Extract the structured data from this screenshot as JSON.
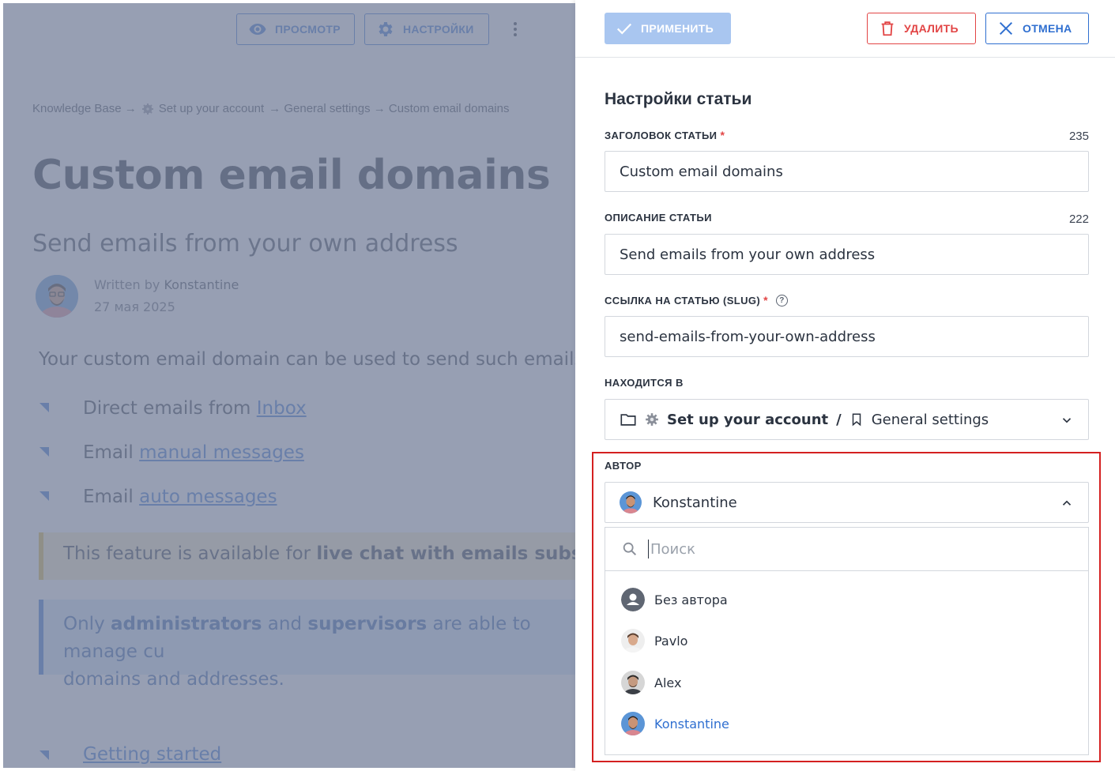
{
  "article": {
    "toolbar": {
      "preview_label": "ПРОСМОТР",
      "settings_label": "НАСТРОЙКИ"
    },
    "breadcrumb": {
      "root": "Knowledge Base →",
      "section": "Set up your account",
      "rest": "→ General settings → Custom email domains"
    },
    "title": "Custom email domains",
    "subtitle": "Send emails from your own address",
    "author": {
      "written_by": "Written by",
      "name": "Konstantine",
      "date": "27 мая 2025"
    },
    "intro": "Your custom email domain can be used to send such emails fro",
    "list": [
      {
        "prefix": "Direct emails from ",
        "link": "Inbox"
      },
      {
        "prefix": "Email ",
        "link": "manual messages"
      },
      {
        "prefix": "Email ",
        "link": "auto messages"
      }
    ],
    "callout_warning": {
      "prefix": "This feature is available for ",
      "bold": "live chat with emails subscripti"
    },
    "callout_info": {
      "p1": "Only ",
      "b1": "administrators",
      "p2": " and ",
      "b2": "supervisors",
      "p3": " are able to manage cu",
      "line2": "domains and addresses."
    },
    "getting_started": "Getting started"
  },
  "panel": {
    "buttons": {
      "apply": "ПРИМЕНИТЬ",
      "delete": "УДАЛИТЬ",
      "cancel": "ОТМЕНА"
    },
    "title": "Настройки статьи",
    "fields": {
      "title_label": "ЗАГОЛОВОК СТАТЬИ",
      "title_count": "235",
      "title_value": "Custom email domains",
      "desc_label": "ОПИСАНИЕ СТАТЬИ",
      "desc_count": "222",
      "desc_value": "Send emails from your own address",
      "slug_label": "ССЫЛКА НА СТАТЬЮ (SLUG)",
      "slug_value": "send-emails-from-your-own-address",
      "location_label": "НАХОДИТСЯ В",
      "location_section": "Set up your account",
      "location_separator": "/",
      "location_category": "General settings",
      "required_mark": "*",
      "help_mark": "?"
    },
    "author_field": {
      "label": "АВТОР",
      "selected": "Konstantine",
      "search_placeholder": "Поиск",
      "options": [
        {
          "name": "Без автора",
          "selected": false
        },
        {
          "name": "Pavlo",
          "selected": false
        },
        {
          "name": "Alex",
          "selected": false
        },
        {
          "name": "Konstantine",
          "selected": true
        }
      ]
    }
  },
  "colors": {
    "accent": "#2f6fd0",
    "danger": "#e24545",
    "highlight": "#d42020",
    "overlay": "#7a849e"
  }
}
